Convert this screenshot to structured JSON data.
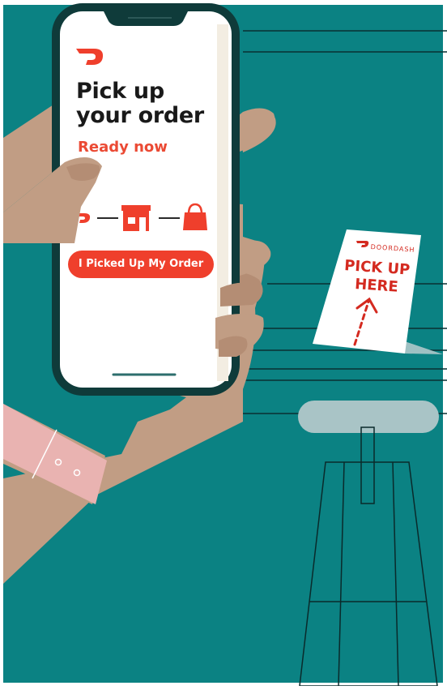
{
  "phone": {
    "title_line1": "Pick up",
    "title_line2": "your order",
    "status": "Ready now",
    "button_label": "I Picked Up My Order"
  },
  "sign": {
    "brand": "DOORDASH",
    "line1": "PICK UP",
    "line2": "HERE"
  },
  "colors": {
    "background_teal": "#0b8283",
    "doordash_red": "#ef3f2c",
    "skin": "#c19d84",
    "phone_frame": "#0f3b3a",
    "wristband": "#e9b3b1"
  },
  "icons": [
    "doordash-logo-icon",
    "store-icon",
    "shopping-bag-icon"
  ]
}
